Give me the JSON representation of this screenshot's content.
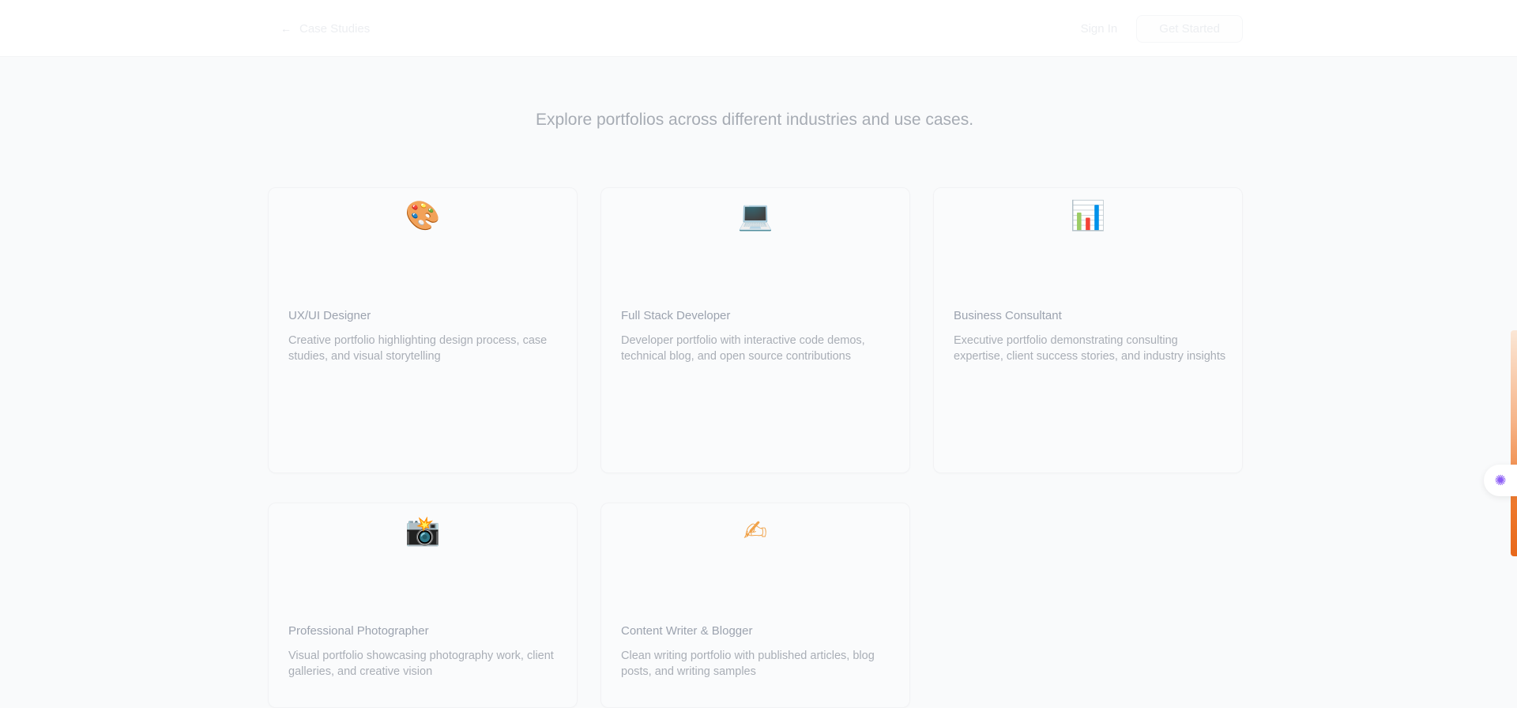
{
  "header": {
    "back_label": "Case Studies",
    "signin_label": "Sign In",
    "start_label": "Get Started"
  },
  "subtitle": "Explore portfolios across different industries and use cases.",
  "cards": [
    {
      "icon": "palette-icon",
      "glyph": "🎨",
      "title": "UX/UI Designer",
      "description": "Creative portfolio highlighting design process, case studies, and visual storytelling"
    },
    {
      "icon": "laptop-icon",
      "glyph": "💻",
      "title": "Full Stack Developer",
      "description": "Developer portfolio with interactive code demos, technical blog, and open source contributions"
    },
    {
      "icon": "bar-chart-icon",
      "glyph": "📊",
      "title": "Business Consultant",
      "description": "Executive portfolio demonstrating consulting expertise, client success stories, and industry insights"
    },
    {
      "icon": "camera-icon",
      "glyph": "📸",
      "title": "Professional Photographer",
      "description": "Visual portfolio showcasing photography work, client galleries, and creative vision"
    },
    {
      "icon": "writing-hand-icon",
      "glyph": "✍",
      "title": "Content Writer & Blogger",
      "description": "Clean writing portfolio with published articles, blog posts, and writing samples"
    }
  ],
  "float_button": {
    "icon": "brain-icon",
    "glyph": "✺"
  },
  "colors": {
    "background": "#f9fafb",
    "accent": "#e8681a"
  }
}
